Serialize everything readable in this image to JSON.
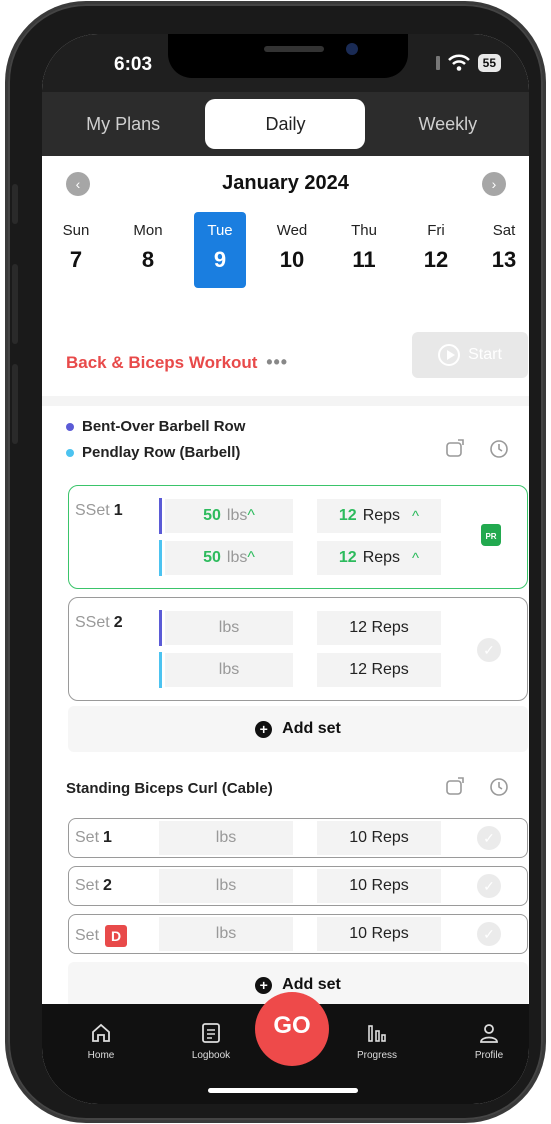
{
  "status": {
    "time": "6:03",
    "battery": "55"
  },
  "tabs": [
    {
      "label": "My Plans"
    },
    {
      "label": "Daily"
    },
    {
      "label": "Weekly"
    }
  ],
  "calendar": {
    "month": "January 2024",
    "days": [
      {
        "name": "Sun",
        "date": "7"
      },
      {
        "name": "Mon",
        "date": "8"
      },
      {
        "name": "Tue",
        "date": "9"
      },
      {
        "name": "Wed",
        "date": "10"
      },
      {
        "name": "Thu",
        "date": "11"
      },
      {
        "name": "Fri",
        "date": "12"
      },
      {
        "name": "Sat",
        "date": "13"
      }
    ]
  },
  "workout": {
    "title": "Back & Biceps Workout",
    "more": "•••",
    "start_label": "Start"
  },
  "superset": {
    "exercises": [
      {
        "name": "Bent-Over Barbell Row",
        "color": "#5b5bd6"
      },
      {
        "name": "Pendlay Row (Barbell)",
        "color": "#4cc3f0"
      }
    ],
    "sets": [
      {
        "prefix": "SSet",
        "number": "1",
        "rows": [
          {
            "weight": "50",
            "unit": "lbs",
            "reps": "12",
            "reps_unit": "Reps"
          },
          {
            "weight": "50",
            "unit": "lbs",
            "reps": "12",
            "reps_unit": "Reps"
          }
        ],
        "badge": "PR"
      },
      {
        "prefix": "SSet",
        "number": "2",
        "rows": [
          {
            "weight": "",
            "unit": "lbs",
            "reps": "12 Reps"
          },
          {
            "weight": "",
            "unit": "lbs",
            "reps": "12 Reps"
          }
        ]
      }
    ],
    "add_set": "Add set"
  },
  "exercise2": {
    "name": "Standing Biceps Curl (Cable)",
    "sets": [
      {
        "prefix": "Set",
        "number": "1",
        "unit": "lbs",
        "reps": "10 Reps"
      },
      {
        "prefix": "Set",
        "number": "2",
        "unit": "lbs",
        "reps": "10 Reps"
      },
      {
        "prefix": "Set",
        "number": "D",
        "unit": "lbs",
        "reps": "10 Reps"
      }
    ],
    "add_set": "Add set"
  },
  "nav": {
    "home": "Home",
    "logbook": "Logbook",
    "go": "GO",
    "progress": "Progress",
    "profile": "Profile"
  }
}
